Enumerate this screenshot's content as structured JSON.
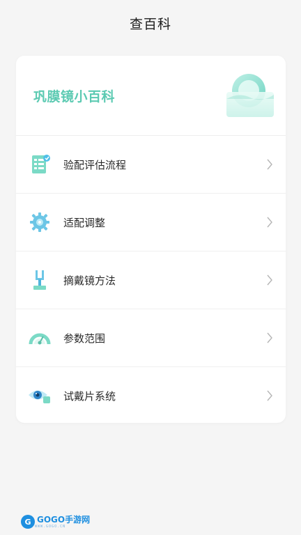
{
  "header": {
    "title": "查百科"
  },
  "card": {
    "title": "巩膜镜小百科",
    "items": [
      {
        "label": "验配评估流程",
        "icon": "checklist-icon"
      },
      {
        "label": "适配调整",
        "icon": "gear-icon"
      },
      {
        "label": "摘戴镜方法",
        "icon": "lens-tool-icon"
      },
      {
        "label": "参数范围",
        "icon": "gauge-icon"
      },
      {
        "label": "试戴片系统",
        "icon": "eye-icon"
      }
    ]
  },
  "watermark": {
    "logo": "G",
    "brand": "GOGO手游网",
    "sub": "WWW.GOGO.CN"
  },
  "colors": {
    "accent": "#5ccab2",
    "background": "#f5f5f5",
    "card": "#ffffff"
  }
}
